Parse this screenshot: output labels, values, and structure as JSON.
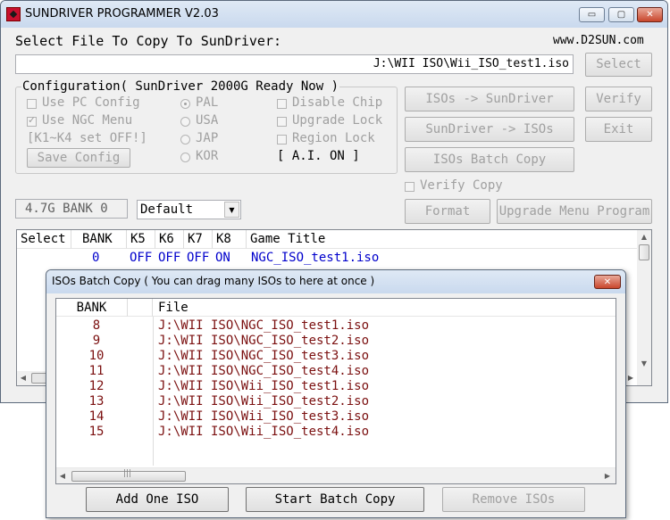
{
  "main": {
    "title": "SUNDRIVER PROGRAMMER V2.03",
    "caption_buttons": {
      "minimize": "▭",
      "maximize": "▢",
      "close": "✕"
    },
    "select_file_label": "Select File To Copy To SunDriver:",
    "website": "www.D2SUN.com",
    "file_path": "J:\\WII ISO\\Wii_ISO_test1.iso",
    "select_button": "Select",
    "config": {
      "legend": "Configuration( SunDriver 2000G Ready Now )",
      "use_pc_config": "Use PC Config",
      "use_ngc_menu": "Use NGC Menu",
      "k1k4_note": "[K1~K4 set OFF!]",
      "save_config": "Save Config",
      "regions": [
        "PAL",
        "USA",
        "JAP",
        "KOR"
      ],
      "disable_chip": "Disable Chip",
      "upgrade_lock": "Upgrade Lock",
      "region_lock": "Region Lock",
      "ai_status": "[ A.I. ON ]"
    },
    "buttons": {
      "isos_to_sundriver": "ISOs -> SunDriver",
      "sundriver_to_isos": "SunDriver -> ISOs",
      "isos_batch_copy": "ISOs Batch Copy",
      "verify": "Verify",
      "exit": "Exit",
      "format": "Format",
      "upgrade_menu_program": "Upgrade Menu Program"
    },
    "verify_copy": "Verify Copy",
    "bank_display": "4.7G BANK 0",
    "profile_select": "Default",
    "list": {
      "headers": [
        "Select",
        "BANK",
        "K5",
        "K6",
        "K7",
        "K8",
        "Game Title"
      ],
      "rows": [
        {
          "bank": "0",
          "k5": "OFF",
          "k6": "OFF",
          "k7": "OFF",
          "k8": "ON",
          "title": "NGC_ISO_test1.iso"
        }
      ]
    }
  },
  "batch": {
    "title": "ISOs Batch Copy  ( You can drag many ISOs to here at once )",
    "close": "✕",
    "headers": {
      "bank": "BANK",
      "file": "File"
    },
    "rows": [
      {
        "bank": "8",
        "file": "J:\\WII ISO\\NGC_ISO_test1.iso"
      },
      {
        "bank": "9",
        "file": "J:\\WII ISO\\NGC_ISO_test2.iso"
      },
      {
        "bank": "10",
        "file": "J:\\WII ISO\\NGC_ISO_test3.iso"
      },
      {
        "bank": "11",
        "file": "J:\\WII ISO\\NGC_ISO_test4.iso"
      },
      {
        "bank": "12",
        "file": "J:\\WII ISO\\Wii_ISO_test1.iso"
      },
      {
        "bank": "13",
        "file": "J:\\WII ISO\\Wii_ISO_test2.iso"
      },
      {
        "bank": "14",
        "file": "J:\\WII ISO\\Wii_ISO_test3.iso"
      },
      {
        "bank": "15",
        "file": "J:\\WII ISO\\Wii_ISO_test4.iso"
      }
    ],
    "add_one_iso": "Add One ISO",
    "start_batch_copy": "Start Batch Copy",
    "remove_isos": "Remove ISOs"
  }
}
